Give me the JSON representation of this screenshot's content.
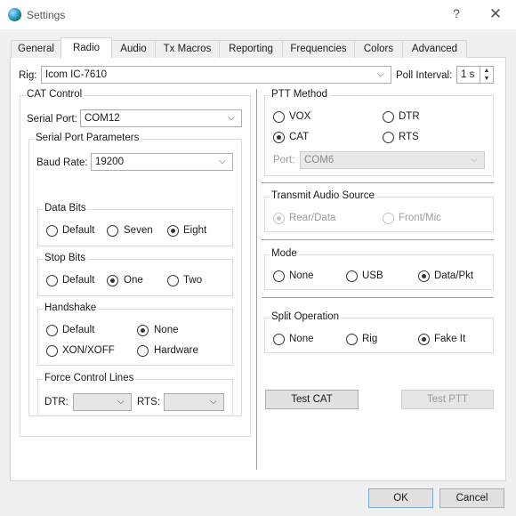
{
  "window": {
    "title": "Settings",
    "help": "?",
    "close": "✕"
  },
  "tabs": [
    "General",
    "Radio",
    "Audio",
    "Tx Macros",
    "Reporting",
    "Frequencies",
    "Colors",
    "Advanced"
  ],
  "active_tab": "Radio",
  "rig": {
    "label": "Rig:",
    "value": "Icom IC-7610",
    "poll_label": "Poll Interval:",
    "poll_value": "1 s"
  },
  "cat_control": {
    "title": "CAT Control",
    "serial_port_label": "Serial Port:",
    "serial_port_value": "COM12",
    "params_title": "Serial Port Parameters",
    "baud_label": "Baud Rate:",
    "baud_value": "19200",
    "data_bits": {
      "title": "Data Bits",
      "options": [
        "Default",
        "Seven",
        "Eight"
      ],
      "selected": "Eight"
    },
    "stop_bits": {
      "title": "Stop Bits",
      "options": [
        "Default",
        "One",
        "Two"
      ],
      "selected": "One"
    },
    "handshake": {
      "title": "Handshake",
      "options": [
        "Default",
        "None",
        "XON/XOFF",
        "Hardware"
      ],
      "selected": "None"
    },
    "force_lines": {
      "title": "Force Control Lines",
      "dtr_label": "DTR:",
      "dtr_value": "",
      "rts_label": "RTS:",
      "rts_value": ""
    }
  },
  "ptt_method": {
    "title": "PTT Method",
    "options": [
      "VOX",
      "DTR",
      "CAT",
      "RTS"
    ],
    "selected": "CAT",
    "port_label": "Port:",
    "port_value": "COM6"
  },
  "transmit_audio_source": {
    "title": "Transmit Audio Source",
    "options": [
      "Rear/Data",
      "Front/Mic"
    ],
    "selected": "Rear/Data",
    "disabled": true
  },
  "mode": {
    "title": "Mode",
    "options": [
      "None",
      "USB",
      "Data/Pkt"
    ],
    "selected": "Data/Pkt"
  },
  "split_operation": {
    "title": "Split Operation",
    "options": [
      "None",
      "Rig",
      "Fake It"
    ],
    "selected": "Fake It"
  },
  "buttons": {
    "test_cat": "Test CAT",
    "test_ptt": "Test PTT",
    "ok": "OK",
    "cancel": "Cancel"
  },
  "icons": {
    "app": "app-globe-icon",
    "help": "question-mark-icon",
    "close": "close-icon",
    "dropdown": "chevron-down-icon",
    "spin": "spin-arrows-icon"
  }
}
